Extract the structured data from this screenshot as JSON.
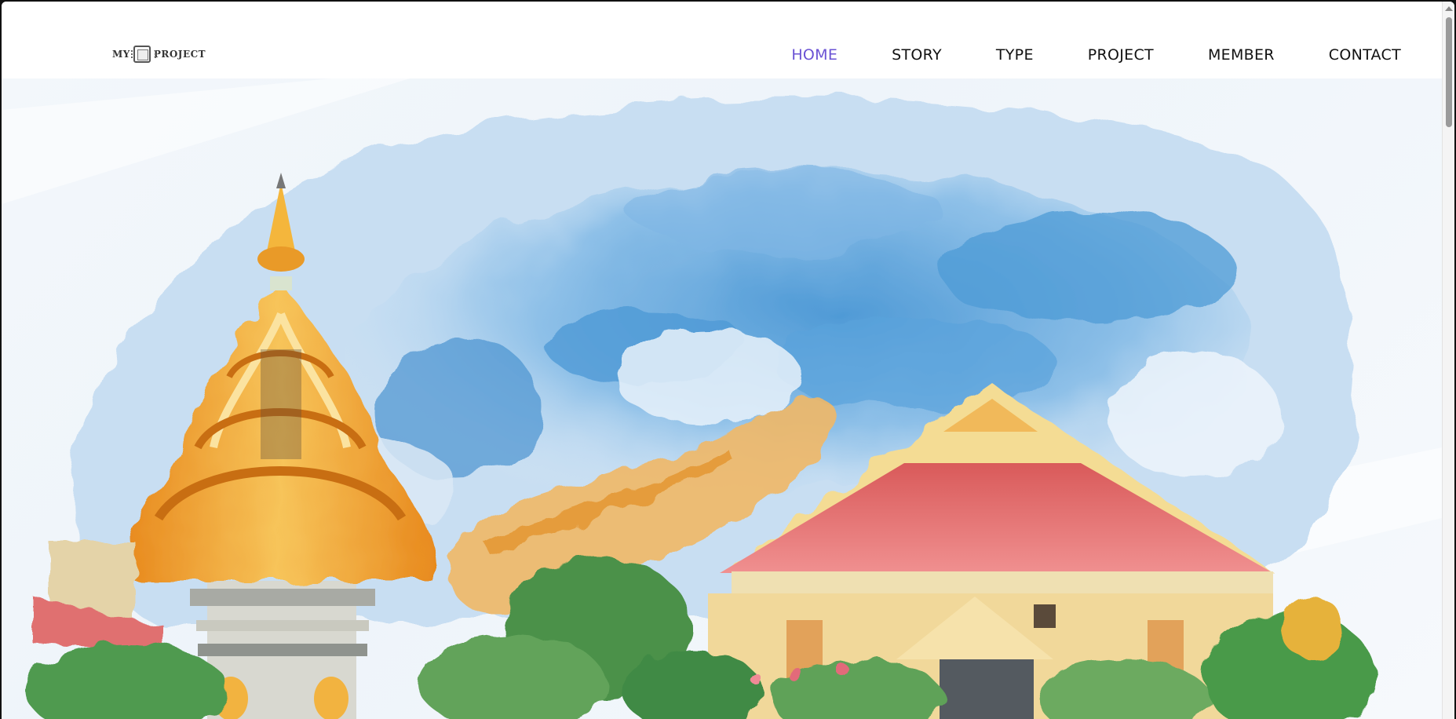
{
  "logo": {
    "text_left": "MY",
    "text_right": "PROJECT",
    "icon": "chip-icon"
  },
  "nav": {
    "items": [
      {
        "label": "HOME",
        "active": true
      },
      {
        "label": "STORY",
        "active": false
      },
      {
        "label": "TYPE",
        "active": false
      },
      {
        "label": "PROJECT",
        "active": false
      },
      {
        "label": "MEMBER",
        "active": false
      },
      {
        "label": "CONTACT",
        "active": false
      }
    ]
  },
  "hero": {
    "description_icon": "watercolor-landscape-image"
  },
  "colors": {
    "nav_active": "#6a52d4",
    "nav_text": "#111111",
    "sky": "#5aa6dc",
    "roof": "#e06a6a",
    "gold": "#f2a83a",
    "foliage": "#4b9a4b"
  }
}
